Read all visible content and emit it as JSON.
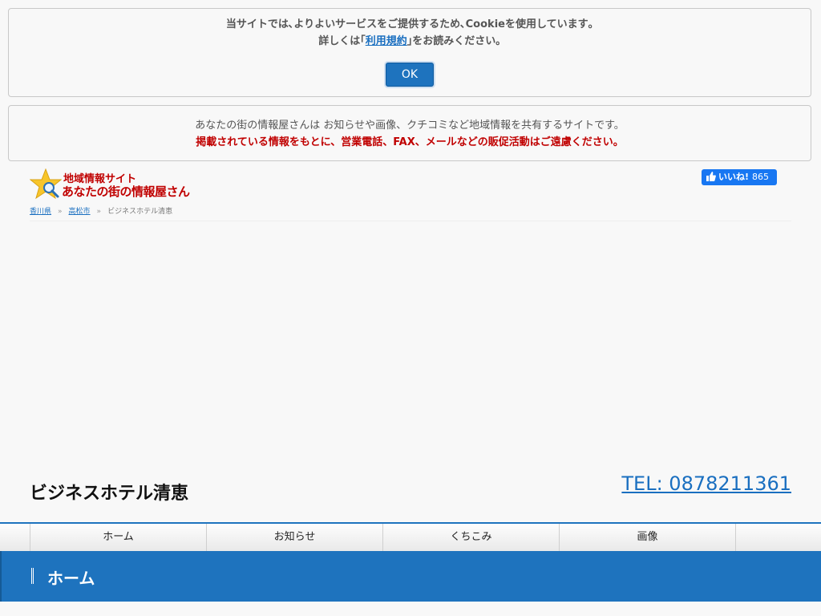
{
  "cookie_notice": {
    "line1": "当サイトでは､よりよいサービスをご提供するため､Cookieを使用しています｡",
    "line2_prefix": "詳しくは｢",
    "terms_link": "利用規約",
    "line2_suffix": "｣をお読みください｡",
    "ok_button": "OK"
  },
  "site_info": {
    "line1": "あなたの街の情報屋さんは お知らせや画像、クチコミなど地域情報を共有するサイトです。",
    "warning": "掲載されている情報をもとに、営業電話、FAX、メールなどの販促活動はご遠慮ください。"
  },
  "logo": {
    "line1": "地域情報サイト",
    "line2": "あなたの街の情報屋さん"
  },
  "facebook": {
    "label": "いいね!",
    "count": "865"
  },
  "breadcrumb": {
    "items": [
      "香川県",
      "高松市"
    ],
    "separator": "»",
    "current": "ビジネスホテル清恵"
  },
  "business": {
    "name": "ビジネスホテル清恵",
    "tel": "TEL: 0878211361"
  },
  "nav": {
    "items": [
      "ホーム",
      "お知らせ",
      "くちこみ",
      "画像"
    ]
  },
  "section": {
    "title": "ホーム"
  },
  "colors": {
    "accent": "#1e73be",
    "warning": "#c00000",
    "facebook": "#1877f2"
  }
}
